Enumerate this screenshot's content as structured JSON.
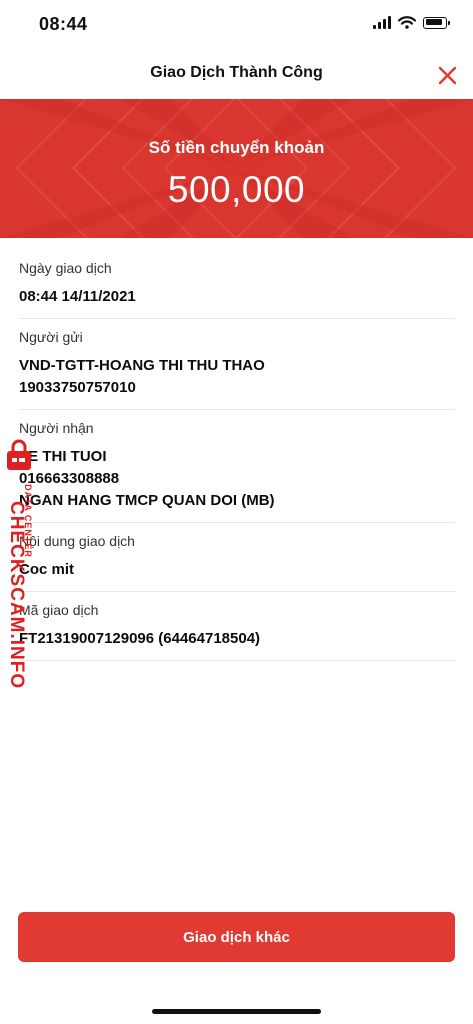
{
  "status_bar": {
    "time": "08:44"
  },
  "header": {
    "title": "Giao Dịch Thành Công"
  },
  "banner": {
    "label": "Số tiền chuyển khoản",
    "amount": "500,000"
  },
  "details": {
    "date": {
      "label": "Ngày giao dịch",
      "value": "08:44 14/11/2021"
    },
    "sender": {
      "label": "Người gửi",
      "lines": [
        "VND-TGTT-HOANG THI THU THAO",
        "19033750757010"
      ]
    },
    "receiver": {
      "label": "Người nhận",
      "lines": [
        "LE THI TUOI",
        "016663308888",
        "NGAN HANG TMCP QUAN DOI (MB)"
      ]
    },
    "content": {
      "label": "Nội dung giao dịch",
      "value": "Coc mit"
    },
    "code": {
      "label": "Mã giao dịch",
      "value": "FT21319007129096 (64464718504)"
    }
  },
  "watermark": {
    "text": "CHECKSCAM.INFO",
    "sub": "DATA CENTER"
  },
  "action": {
    "label": "Giao dịch khác"
  },
  "colors": {
    "brand": "#d9362f",
    "button": "#e03a33"
  },
  "icons": [
    "signal-icon",
    "wifi-icon",
    "battery-icon",
    "close-icon",
    "lock-icon"
  ]
}
